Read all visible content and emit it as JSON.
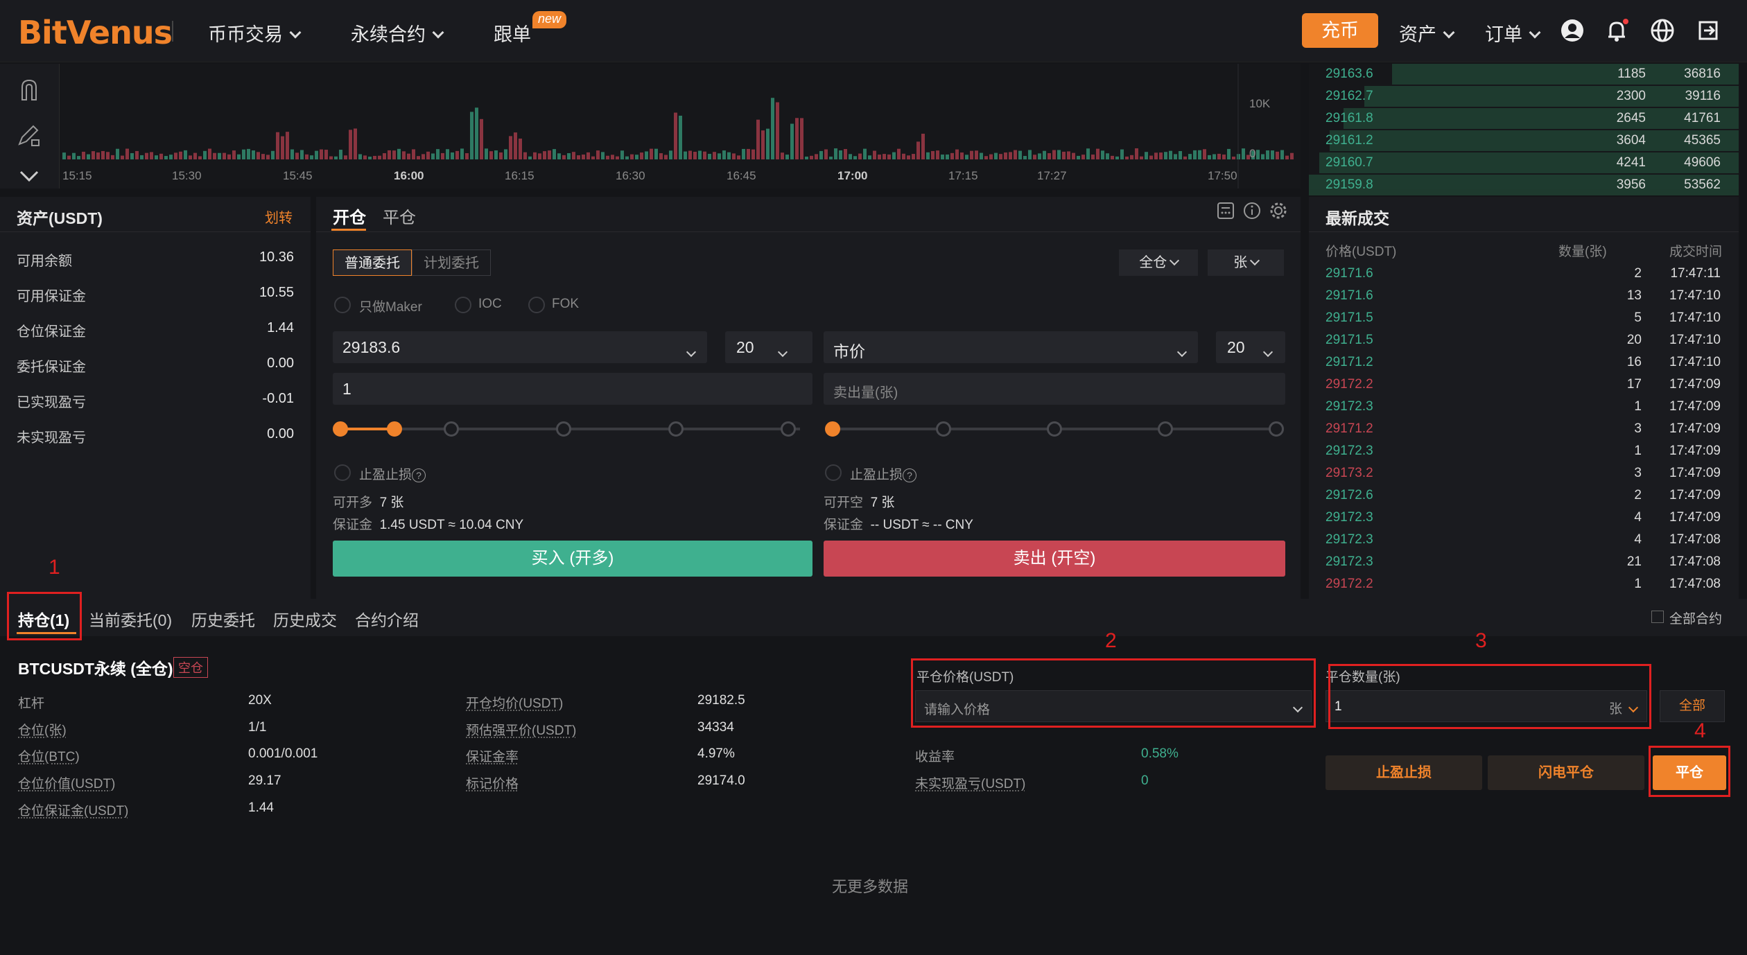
{
  "header": {
    "logo": "BitVenus",
    "nav": [
      "币币交易",
      "永续合约",
      "跟单"
    ],
    "new_badge": "new",
    "charge": "充币",
    "assets": "资产",
    "orders": "订单"
  },
  "chart": {
    "x_ticks": [
      "15:15",
      "15:30",
      "15:45",
      "16:00",
      "16:15",
      "16:30",
      "16:45",
      "17:00",
      "17:15",
      "17:27",
      "17:50"
    ],
    "y_ticks": [
      "10K",
      "0"
    ]
  },
  "orderbook_top": [
    {
      "price": "29163.6",
      "qty": "1185",
      "total": "36816"
    },
    {
      "price": "29162.7",
      "qty": "2300",
      "total": "39116"
    },
    {
      "price": "29161.8",
      "qty": "2645",
      "total": "41761"
    },
    {
      "price": "29161.2",
      "qty": "3604",
      "total": "45365"
    },
    {
      "price": "29160.7",
      "qty": "4241",
      "total": "49606"
    },
    {
      "price": "29159.8",
      "qty": "3956",
      "total": "53562"
    }
  ],
  "assets": {
    "title": "资产(USDT)",
    "transfer": "划转",
    "rows": [
      {
        "label": "可用余额",
        "value": "10.36"
      },
      {
        "label": "可用保证金",
        "value": "10.55"
      },
      {
        "label": "仓位保证金",
        "value": "1.44"
      },
      {
        "label": "委托保证金",
        "value": "0.00"
      },
      {
        "label": "已实现盈亏",
        "value": "-0.01"
      },
      {
        "label": "未实现盈亏",
        "value": "0.00"
      }
    ]
  },
  "trade": {
    "tab_open": "开仓",
    "tab_close": "平仓",
    "order_normal": "普通委托",
    "order_plan": "计划委托",
    "margin_mode": "全仓",
    "unit": "张",
    "opt_maker": "只做Maker",
    "opt_ioc": "IOC",
    "opt_fok": "FOK",
    "buy": {
      "price": "29183.6",
      "leverage": "20",
      "qty": "1",
      "tpsl": "止盈止损",
      "avail_label": "可开多",
      "avail": "7 张",
      "margin_label": "保证金",
      "margin": "1.45 USDT ≈ 10.04 CNY",
      "button": "买入 (开多)"
    },
    "sell": {
      "price": "市价",
      "leverage": "20",
      "qty_placeholder": "卖出量(张)",
      "tpsl": "止盈止损",
      "avail_label": "可开空",
      "avail": "7 张",
      "margin_label": "保证金",
      "margin": "-- USDT ≈ -- CNY",
      "button": "卖出 (开空)"
    }
  },
  "trades": {
    "title": "最新成交",
    "headers": [
      "价格(USDT)",
      "数量(张)",
      "成交时间"
    ],
    "rows": [
      {
        "price": "29171.6",
        "qty": "2",
        "time": "17:47:11",
        "side": "buy"
      },
      {
        "price": "29171.6",
        "qty": "13",
        "time": "17:47:10",
        "side": "buy"
      },
      {
        "price": "29171.5",
        "qty": "5",
        "time": "17:47:10",
        "side": "buy"
      },
      {
        "price": "29171.5",
        "qty": "20",
        "time": "17:47:10",
        "side": "buy"
      },
      {
        "price": "29171.2",
        "qty": "16",
        "time": "17:47:10",
        "side": "buy"
      },
      {
        "price": "29172.2",
        "qty": "17",
        "time": "17:47:09",
        "side": "sell"
      },
      {
        "price": "29172.3",
        "qty": "1",
        "time": "17:47:09",
        "side": "buy"
      },
      {
        "price": "29171.2",
        "qty": "3",
        "time": "17:47:09",
        "side": "sell"
      },
      {
        "price": "29172.3",
        "qty": "1",
        "time": "17:47:09",
        "side": "buy"
      },
      {
        "price": "29173.2",
        "qty": "3",
        "time": "17:47:09",
        "side": "sell"
      },
      {
        "price": "29172.6",
        "qty": "2",
        "time": "17:47:09",
        "side": "buy"
      },
      {
        "price": "29172.3",
        "qty": "4",
        "time": "17:47:09",
        "side": "buy"
      },
      {
        "price": "29172.3",
        "qty": "4",
        "time": "17:47:08",
        "side": "buy"
      },
      {
        "price": "29172.3",
        "qty": "21",
        "time": "17:47:08",
        "side": "buy"
      },
      {
        "price": "29172.2",
        "qty": "1",
        "time": "17:47:08",
        "side": "sell"
      }
    ]
  },
  "positions": {
    "tabs": [
      "持仓(1)",
      "当前委托(0)",
      "历史委托",
      "历史成交",
      "合约介绍"
    ],
    "all_contracts": "全部合约",
    "symbol": "BTCUSDT永续 (全仓)",
    "side_badge": "空仓",
    "col1": [
      {
        "label": "杠杆",
        "value": "20X"
      },
      {
        "label": "仓位(张)",
        "value": "1/1"
      },
      {
        "label": "仓位(BTC)",
        "value": "0.001/0.001"
      },
      {
        "label": "仓位价值(USDT)",
        "value": "29.17"
      },
      {
        "label": "仓位保证金(USDT)",
        "value": "1.44"
      }
    ],
    "col2": [
      {
        "label": "开仓均价(USDT)",
        "value": "29182.5"
      },
      {
        "label": "预估强平价(USDT)",
        "value": "34334"
      },
      {
        "label": "保证金率",
        "value": "4.97%"
      },
      {
        "label": "标记价格",
        "value": "29174.0"
      }
    ],
    "close_price_label": "平仓价格(USDT)",
    "close_price_placeholder": "请输入价格",
    "close_qty_label": "平仓数量(张)",
    "close_qty": "1",
    "close_qty_unit": "张",
    "all_btn": "全部",
    "yield_label": "收益率",
    "yield": "0.58%",
    "upnl_label": "未实现盈亏(USDT)",
    "upnl": "0",
    "btn_tpsl": "止盈止损",
    "btn_flash": "闪电平仓",
    "btn_close": "平仓",
    "no_more": "无更多数据"
  },
  "annotations": [
    "1",
    "2",
    "3",
    "4"
  ],
  "colors": {
    "accent": "#f0832b",
    "green": "#3fb08f",
    "red": "#c84653",
    "annotation": "#e02020"
  }
}
